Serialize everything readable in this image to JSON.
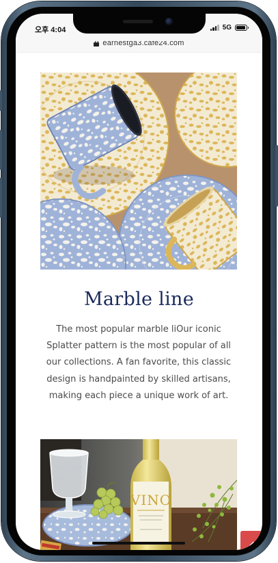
{
  "status_bar": {
    "time": "오후 4:04",
    "network": "5G",
    "signal_bars": 3,
    "battery_level": 0.9
  },
  "browser": {
    "url": "earnestga3.cafe24.com",
    "lock_icon": "lock-icon"
  },
  "section": {
    "image_alt": "Blue and yellow marble splatter enamel mugs and plates",
    "title": "Marble line",
    "description": "The most popular marble liOur iconic Splatter pattern is the most popular of all our collections. A fan favorite, this classic design is handpainted by skilled artisans, making each piece a unique work of art."
  },
  "next_section": {
    "image_alt": "VINO wine bottle, glass and grapes on a blue marble plate",
    "bottle_label": "VINO"
  },
  "scroll_top_button": {
    "icon": "chevron-up-icon",
    "color": "#d94a4a"
  },
  "colors": {
    "title": "#1a2a5c",
    "text": "#4a4a4a",
    "accent": "#d94a4a"
  }
}
